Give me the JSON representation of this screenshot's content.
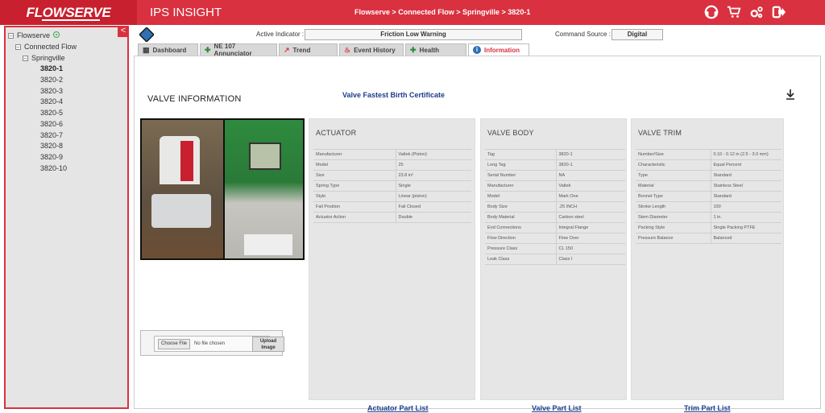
{
  "header": {
    "logo": "FLOWSERVE",
    "app_title": "IPS INSIGHT",
    "breadcrumb": "Flowserve > Connected Flow > Springville > 3820-1"
  },
  "sidebar": {
    "collapse_icon": "<",
    "root": "Flowserve",
    "group": "Connected Flow",
    "site": "Springville",
    "valves": [
      "3820-1",
      "3820-2",
      "3820-3",
      "3820-4",
      "3820-5",
      "3820-6",
      "3820-7",
      "3820-8",
      "3820-9",
      "3820-10"
    ]
  },
  "status_bar": {
    "active_indicator_label": "Active Indicator :",
    "active_indicator_value": "Friction Low Warning",
    "command_source_label": "Command Source :",
    "command_source_value": "Digital"
  },
  "tabs": [
    {
      "label": "Dashboard",
      "icon": "dashboard-icon"
    },
    {
      "label": "NE 107 Annunciator",
      "icon": "annunciator-icon"
    },
    {
      "label": "Trend",
      "icon": "trend-icon"
    },
    {
      "label": "Event History",
      "icon": "event-history-icon"
    },
    {
      "label": "Health",
      "icon": "health-icon"
    },
    {
      "label": "Information",
      "icon": "information-icon"
    }
  ],
  "content": {
    "title": "VALVE INFORMATION",
    "birth_certificate_link": "Valve Fastest Birth Certificate",
    "upload": {
      "choose_label": "Choose File",
      "no_file": "No file chosen",
      "upload_label_1": "Upload",
      "upload_label_2": "Image"
    }
  },
  "actuator": {
    "title": "ACTUATOR",
    "rows": [
      [
        "Manufacturer",
        "Valtek (Piston)"
      ],
      [
        "Model",
        "25"
      ],
      [
        "Size",
        "23.8 in²"
      ],
      [
        "Spring Type",
        "Single"
      ],
      [
        "Style",
        "Linear (piston)"
      ],
      [
        "Fail Position",
        "Fail Closed"
      ],
      [
        "Actuator Action",
        "Double"
      ]
    ],
    "link": "Actuator Part List"
  },
  "valve_body": {
    "title": "VALVE BODY",
    "rows": [
      [
        "Tag",
        "3820-1"
      ],
      [
        "Long Tag",
        "3820-1"
      ],
      [
        "Serial Number",
        "NA"
      ],
      [
        "Manufacturer",
        "Valtek"
      ],
      [
        "Model",
        "Mark One"
      ],
      [
        "Body Size",
        ".25 INCH"
      ],
      [
        "Body Material",
        "Carbon steel"
      ],
      [
        "End Connections",
        "Integral Flange"
      ],
      [
        "Flow Direction",
        "Flow Over"
      ],
      [
        "Pressure Class",
        "CL 150"
      ],
      [
        "Leak Class",
        "Class I"
      ]
    ],
    "link": "Valve Part List"
  },
  "valve_trim": {
    "title": "VALVE TRIM",
    "rows": [
      [
        "Number/Size",
        "0.10 - 0.12 in (2.5 - 3.0 mm)"
      ],
      [
        "Characteristic",
        "Equal Percent"
      ],
      [
        "Type",
        "Standard"
      ],
      [
        "Material",
        "Stainless Steel"
      ],
      [
        "Bonnet Type",
        "Standard"
      ],
      [
        "Stroke Length",
        "100"
      ],
      [
        "Stem Diameter",
        "1 in."
      ],
      [
        "Packing Style",
        "Single Packing PTFE"
      ],
      [
        "Pressure Balance",
        "Balanced"
      ]
    ],
    "link": "Trim Part List"
  },
  "colors": {
    "brand_red": "#d9313f",
    "link_blue": "#1d3c8a"
  }
}
